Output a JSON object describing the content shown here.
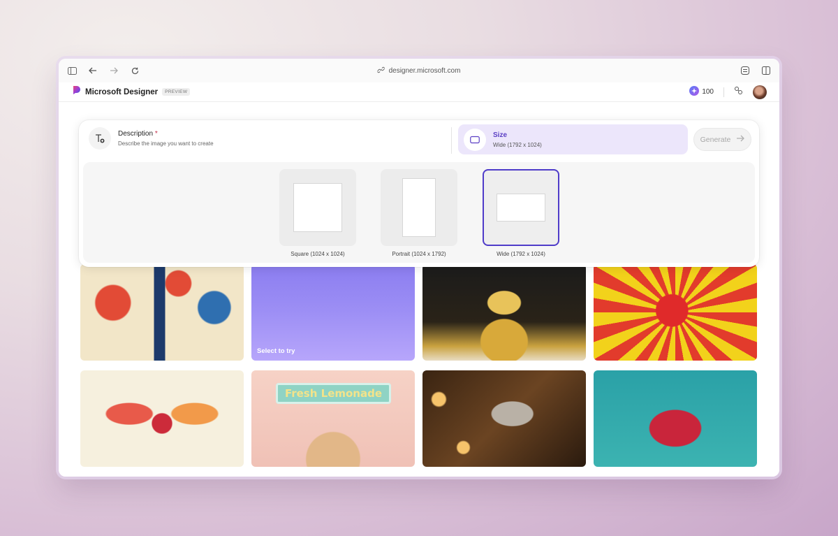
{
  "browser": {
    "url": "designer.microsoft.com",
    "icons": [
      "sidebar-icon",
      "back-icon",
      "forward-icon",
      "reload-icon",
      "link-icon",
      "extension-icon",
      "split-view-icon"
    ]
  },
  "header": {
    "app_name": "Microsoft Designer",
    "badge": "PREVIEW",
    "credits": "100"
  },
  "prompt": {
    "description_title": "Description",
    "required_mark": "*",
    "description_hint": "Describe the image you want to create",
    "size_title": "Size",
    "size_value": "Wide (1792 x 1024)",
    "generate_label": "Generate"
  },
  "size_options": [
    {
      "label": "Square (1024 x 1024)",
      "selected": false
    },
    {
      "label": "Portrait (1024 x 1792)",
      "selected": false
    },
    {
      "label": "Wide (1792 x 1024)",
      "selected": true
    }
  ],
  "gallery": {
    "try_label": "Select to try",
    "sign_text": "Fresh Lemonade"
  },
  "colors": {
    "accent": "#5b3fc4",
    "selected_border": "#4f3cc9",
    "size_tab_bg": "#ece6fb"
  }
}
